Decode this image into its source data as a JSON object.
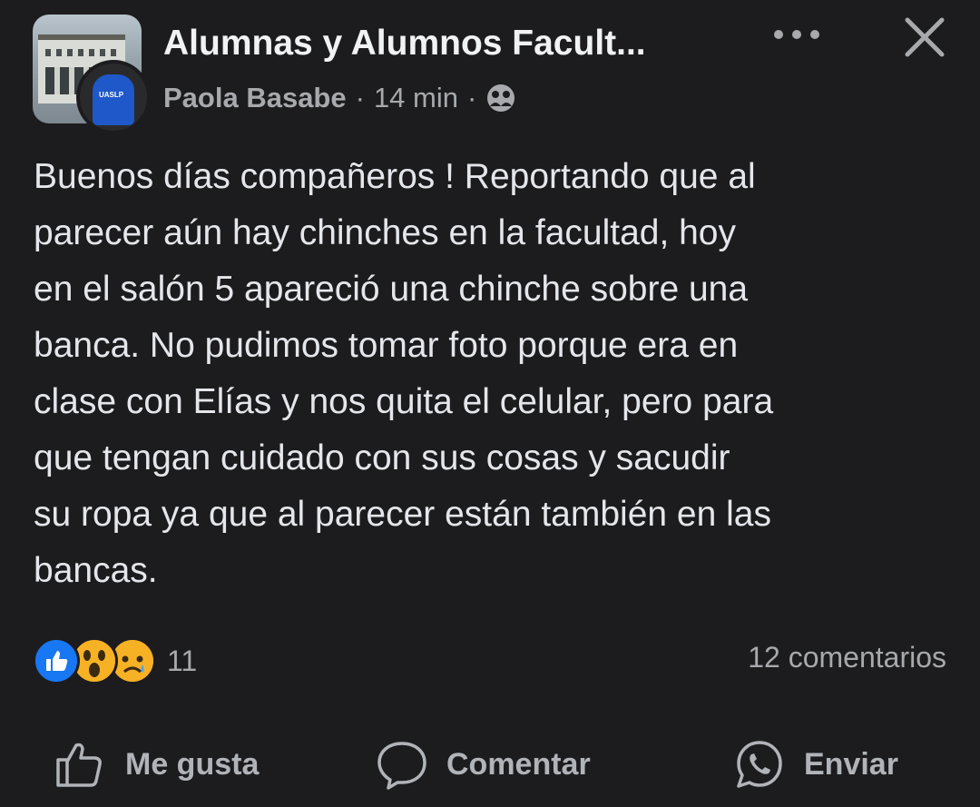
{
  "header": {
    "group_name": "Alumnas y Alumnos Facult...",
    "author": "Paola Basabe",
    "separator": "·",
    "time": "14 min",
    "privacy_icon": "group-icon",
    "more_icon": "more-dots-icon",
    "close_icon": "close-icon",
    "user_avatar_badge": "UASLP"
  },
  "post": {
    "text": "Buenos días compañeros ! Reportando que al\nparecer aún hay chinches en la facultad, hoy\nen el salón 5 apareció una chinche sobre una\nbanca. No pudimos tomar foto porque era en\nclase con Elías y nos quita el celular, pero para\nque tengan cuidado con sus cosas y sacudir\nsu ropa ya que al parecer están también en las\nbancas."
  },
  "stats": {
    "reaction_icons": [
      "like-icon",
      "wow-icon",
      "sad-icon"
    ],
    "reaction_count": "11",
    "comments": "12 comentarios"
  },
  "actions": {
    "like": "Me gusta",
    "comment": "Comentar",
    "send": "Enviar"
  },
  "colors": {
    "background": "#1c1c1e",
    "text": "#e4e6eb",
    "secondary": "#a7a9ad",
    "like_blue": "#1877f2",
    "emoji_yellow": "#f7b125"
  }
}
